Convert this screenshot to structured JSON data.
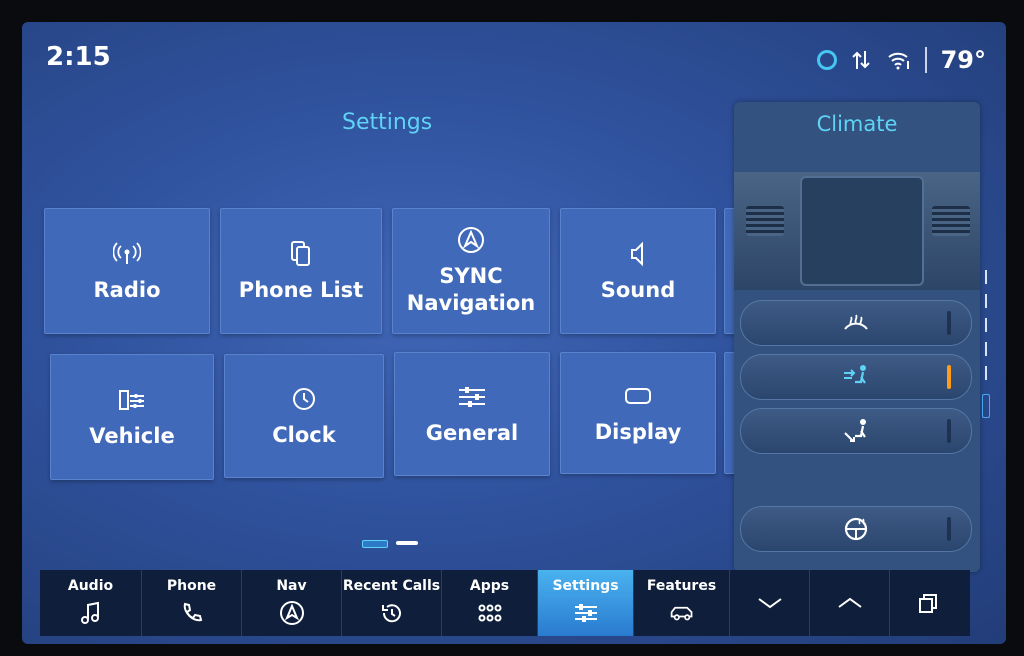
{
  "status": {
    "time": "2:15",
    "temperature": "79°"
  },
  "settings": {
    "title": "Settings",
    "tiles": [
      {
        "label": "Radio",
        "icon": "radio-antenna-icon"
      },
      {
        "label": "Phone List",
        "icon": "phone-list-icon"
      },
      {
        "label": "SYNC\nNavigation",
        "icon": "navigation-icon"
      },
      {
        "label": "Sound",
        "icon": "speaker-icon"
      },
      {
        "label": "Vehicle",
        "icon": "vehicle-settings-icon"
      },
      {
        "label": "Clock",
        "icon": "clock-icon"
      },
      {
        "label": "General",
        "icon": "sliders-icon"
      },
      {
        "label": "Display",
        "icon": "display-icon"
      }
    ]
  },
  "climate": {
    "title": "Climate",
    "buttons": [
      {
        "icon": "front-defrost-icon",
        "active": false
      },
      {
        "icon": "airflow-face-icon",
        "active": true
      },
      {
        "icon": "airflow-feet-icon",
        "active": false
      },
      {
        "icon": "heated-steering-wheel-icon",
        "active": false
      }
    ],
    "accent_on": "#ff9c1a"
  },
  "bottom_bar": {
    "items": [
      {
        "label": "Audio",
        "icon": "music-note-icon"
      },
      {
        "label": "Phone",
        "icon": "phone-icon"
      },
      {
        "label": "Nav",
        "icon": "navigation-icon"
      },
      {
        "label": "Recent Calls",
        "icon": "recent-calls-icon"
      },
      {
        "label": "Apps",
        "icon": "apps-grid-icon"
      },
      {
        "label": "Settings",
        "icon": "settings-sliders-icon",
        "active": true
      },
      {
        "label": "Features",
        "icon": "vehicle-features-icon"
      }
    ],
    "controls": [
      "chevron-down-icon",
      "chevron-up-icon",
      "multi-window-icon"
    ]
  },
  "colors": {
    "accent_cyan": "#5fd3f5",
    "active_tab": "#3a9ae6",
    "tile": "#4069b9"
  }
}
